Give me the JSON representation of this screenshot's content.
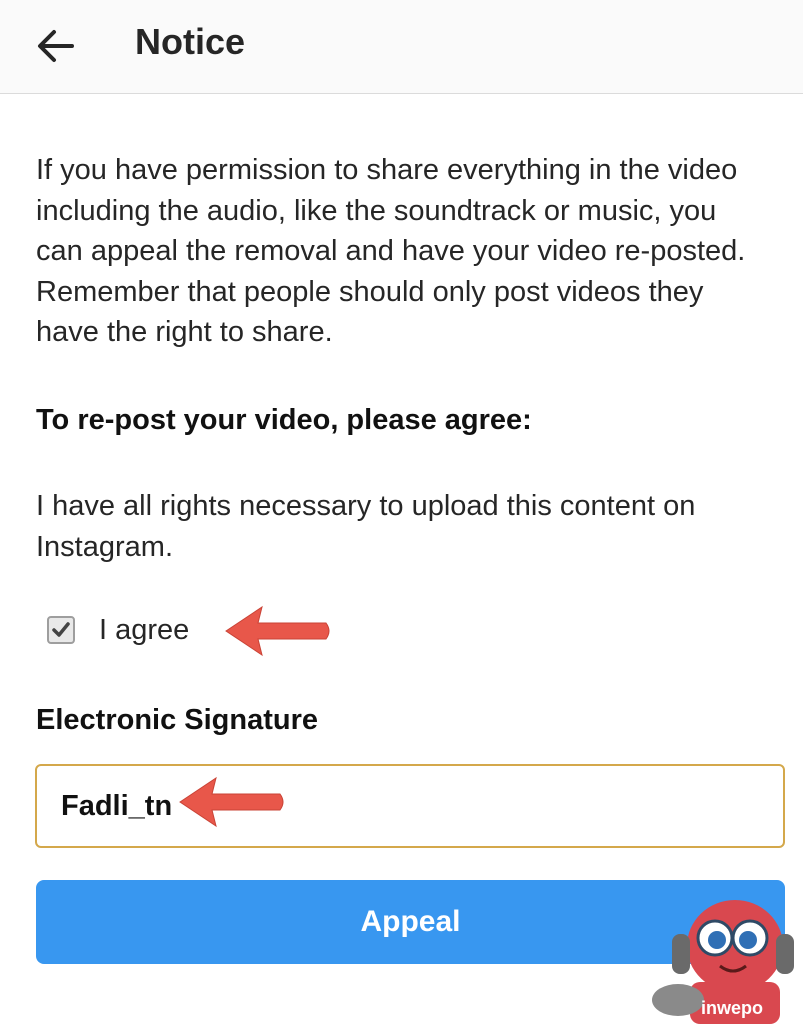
{
  "header": {
    "title": "Notice",
    "back_icon": "arrow-left-icon"
  },
  "notice": {
    "body": "If you have permission to share everything in the video including the audio, like the soundtrack or music, you can appeal the removal and have your video re-posted. Remember that people should only post videos they have the right to share.",
    "heading": "To re-post your video, please agree:",
    "rights_statement": "I have all rights necessary to upload this content on Instagram."
  },
  "agreement": {
    "checked": true,
    "label": "I agree"
  },
  "signature": {
    "heading": "Electronic Signature",
    "value": "Fadli_tn"
  },
  "actions": {
    "appeal_label": "Appeal"
  },
  "watermark": {
    "text": "inwepo"
  },
  "colors": {
    "button": "#3897f0",
    "input_border": "#d4a84b",
    "annotation_arrow": "#e8574a"
  }
}
